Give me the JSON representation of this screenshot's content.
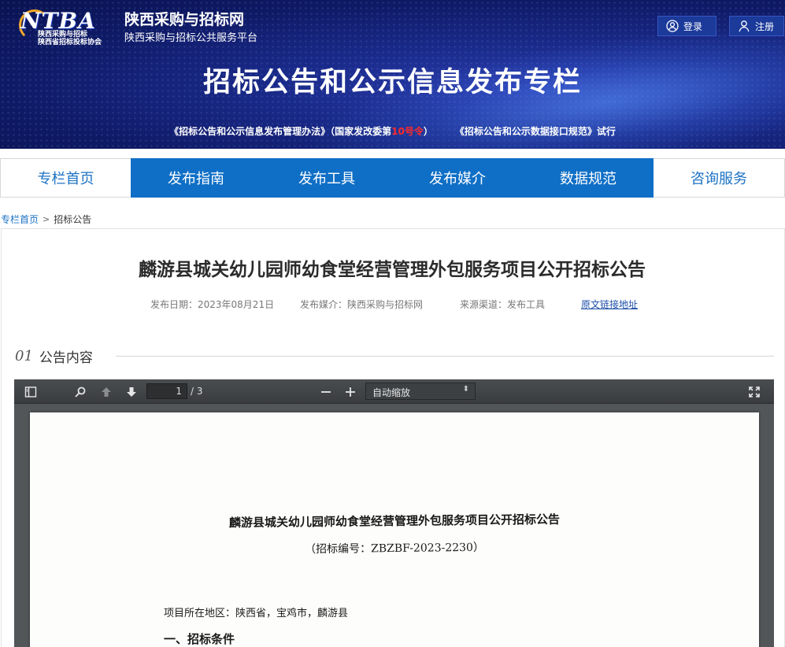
{
  "header": {
    "logo_text": "NTBA",
    "logo_assoc_line1": "陕西采购与招标",
    "logo_assoc_line2": "陕西省招标投标协会",
    "site_name": "陕西采购与招标网",
    "site_subtitle": "陕西采购与招标公共服务平台",
    "login_label": "登录",
    "register_label": "注册",
    "banner_title": "招标公告和公示信息发布专栏",
    "notice": {
      "part1": "《招标公告和公示信息发布管理办法》（国家发改委第",
      "highlight": "10号令",
      "part2": "）",
      "part3": "《招标公告和公示数据接口规范》试行"
    }
  },
  "nav": {
    "items": [
      {
        "label": "专栏首页"
      },
      {
        "label": "发布指南"
      },
      {
        "label": "发布工具"
      },
      {
        "label": "发布媒介"
      },
      {
        "label": "数据规范"
      },
      {
        "label": "咨询服务"
      }
    ]
  },
  "breadcrumb": {
    "home": "专栏首页",
    "separator": ">",
    "current": "招标公告"
  },
  "article": {
    "title": "麟游县城关幼儿园师幼食堂经营管理外包服务项目公开招标公告",
    "publish_date": "发布日期：2023年08月21日",
    "publish_media": "发布媒介：陕西采购与招标网",
    "source_channel": "来源渠道：发布工具",
    "original_link": "原文链接地址"
  },
  "section": {
    "number": "01",
    "label": "公告内容"
  },
  "pdf_viewer": {
    "current_page": "1",
    "total_pages": "/ 3",
    "zoom_value": "自动缩放",
    "document": {
      "title": "麟游县城关幼儿园师幼食堂经营管理外包服务项目公开招标公告",
      "code": "（招标编号：ZBZBF-2023-2230）",
      "region": "项目所在地区：陕西省，宝鸡市，麟游县",
      "heading": "一、招标条件"
    }
  },
  "colors": {
    "nav_blue": "#0f6fc6",
    "link_blue": "#1c72c4",
    "notice_red": "#ff2a2a"
  }
}
